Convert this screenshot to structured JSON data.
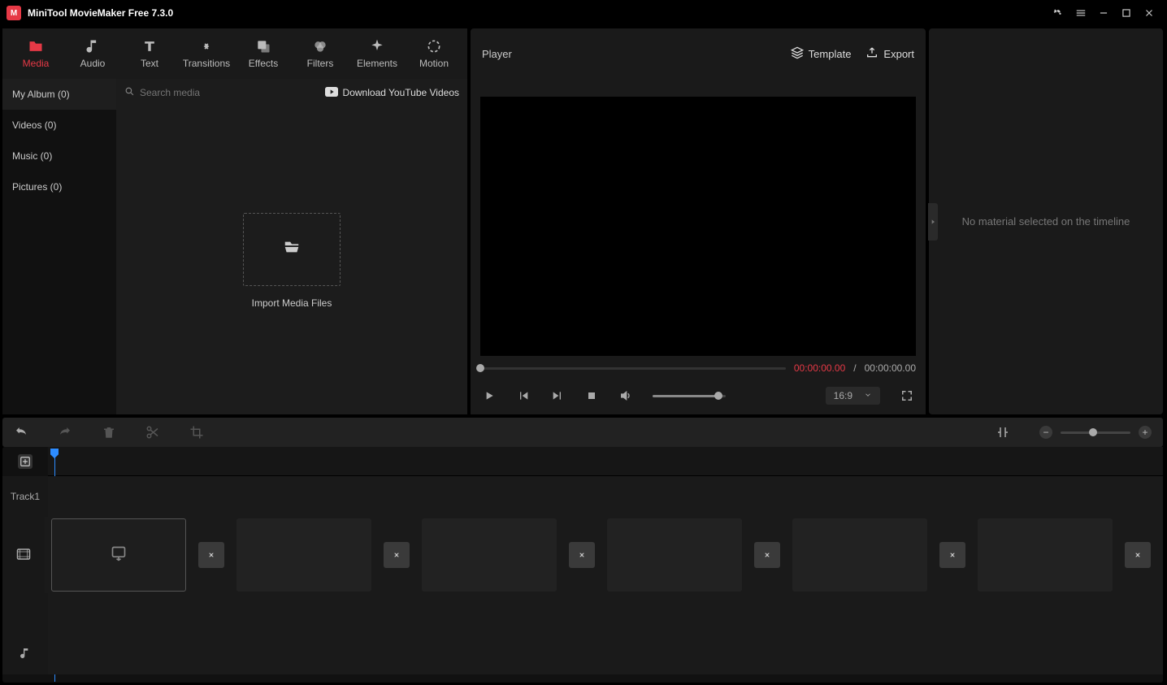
{
  "app": {
    "title": "MiniTool MovieMaker Free 7.3.0"
  },
  "toolbar_tabs": {
    "media": "Media",
    "audio": "Audio",
    "text": "Text",
    "transitions": "Transitions",
    "effects": "Effects",
    "filters": "Filters",
    "elements": "Elements",
    "motion": "Motion"
  },
  "album": {
    "my_album": "My Album (0)",
    "videos": "Videos (0)",
    "music": "Music (0)",
    "pictures": "Pictures (0)"
  },
  "media_panel": {
    "search_placeholder": "Search media",
    "download_youtube": "Download YouTube Videos",
    "import_label": "Import Media Files"
  },
  "player": {
    "label": "Player",
    "template": "Template",
    "export": "Export",
    "time_current": "00:00:00.00",
    "time_sep": "/",
    "time_total": "00:00:00.00",
    "aspect": "16:9"
  },
  "inspector": {
    "empty": "No material selected on the timeline"
  },
  "timeline": {
    "track1": "Track1"
  }
}
